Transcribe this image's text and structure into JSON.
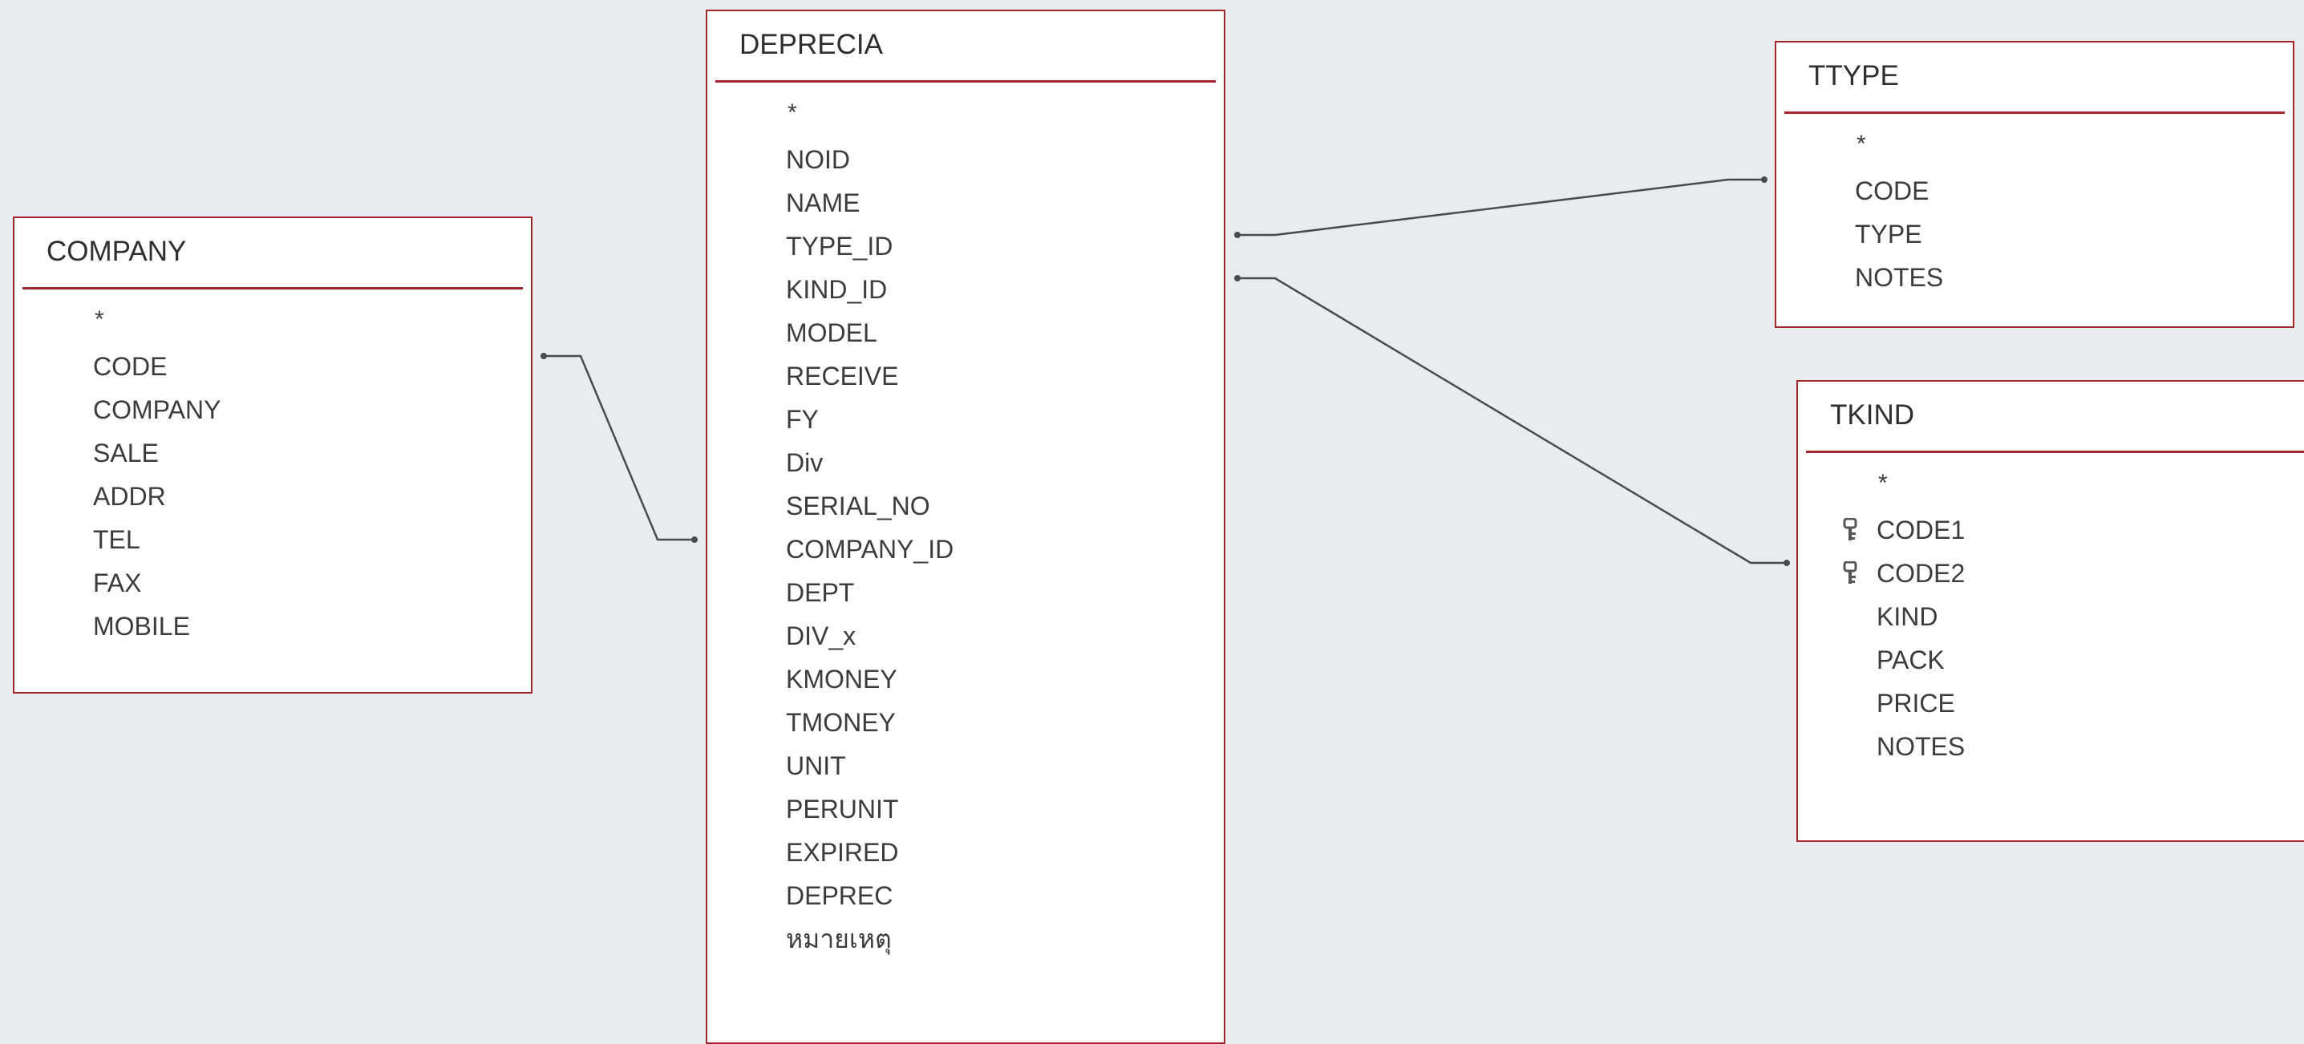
{
  "tables": {
    "company": {
      "title": "COMPANY",
      "fields": [
        "*",
        "CODE",
        "COMPANY",
        "SALE",
        "ADDR",
        "TEL",
        "FAX",
        "MOBILE"
      ]
    },
    "deprecia": {
      "title": "DEPRECIA",
      "fields": [
        "*",
        "NOID",
        "NAME",
        "TYPE_ID",
        "KIND_ID",
        "MODEL",
        "RECEIVE",
        "FY",
        "Div",
        "SERIAL_NO",
        "COMPANY_ID",
        "DEPT",
        "DIV_x",
        "KMONEY",
        "TMONEY",
        "UNIT",
        "PERUNIT",
        "EXPIRED",
        "DEPREC",
        "หมายเหตุ"
      ]
    },
    "ttype": {
      "title": "TTYPE",
      "fields": [
        "*",
        "CODE",
        "TYPE",
        "NOTES"
      ]
    },
    "tkind": {
      "title": "TKIND",
      "fields": [
        "*",
        "CODE1",
        "CODE2",
        "KIND",
        "PACK",
        "PRICE",
        "NOTES"
      ],
      "key_fields": [
        "CODE1",
        "CODE2"
      ]
    }
  },
  "relationships": [
    {
      "from": "COMPANY.CODE",
      "to": "DEPRECIA.COMPANY_ID"
    },
    {
      "from": "DEPRECIA.TYPE_ID",
      "to": "TTYPE.CODE"
    },
    {
      "from": "DEPRECIA.KIND_ID",
      "to": "TKIND.CODE2"
    }
  ],
  "colors": {
    "background": "#e9ecef",
    "table_border": "#a4262c",
    "relationship_line": "#4a4a4a"
  },
  "icons": {
    "primary_key": "key-icon"
  }
}
